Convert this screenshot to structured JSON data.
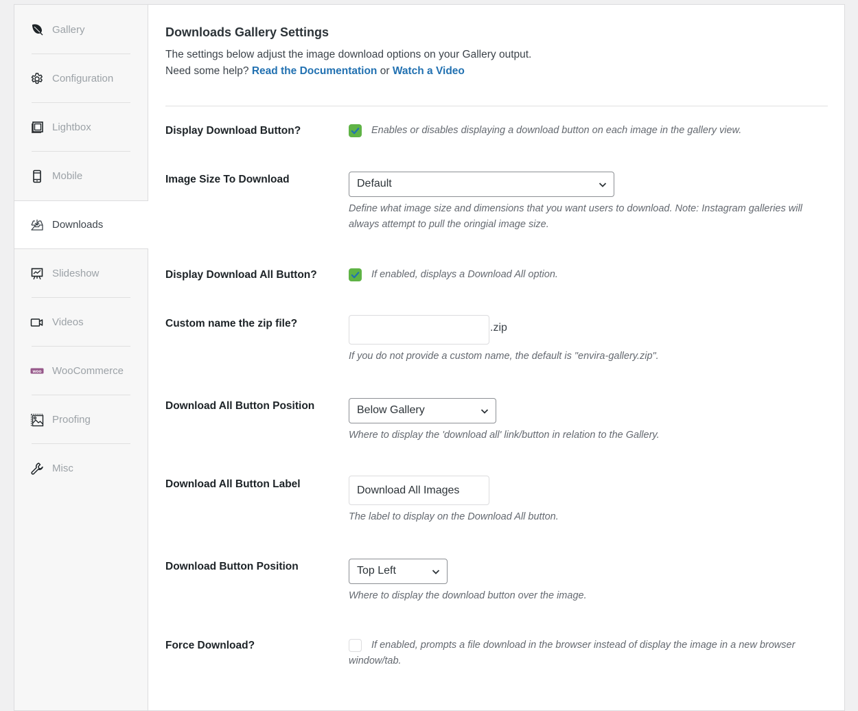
{
  "sidebar": {
    "items": [
      {
        "label": "Gallery",
        "icon": "leaf-icon",
        "active": false
      },
      {
        "label": "Configuration",
        "icon": "gear-icon",
        "active": false
      },
      {
        "label": "Lightbox",
        "icon": "lightbox-icon",
        "active": false
      },
      {
        "label": "Mobile",
        "icon": "mobile-icon",
        "active": false
      },
      {
        "label": "Downloads",
        "icon": "download-tray-icon",
        "active": true
      },
      {
        "label": "Slideshow",
        "icon": "presentation-icon",
        "active": false
      },
      {
        "label": "Videos",
        "icon": "video-camera-icon",
        "active": false
      },
      {
        "label": "WooCommerce",
        "icon": "woo-icon",
        "active": false
      },
      {
        "label": "Proofing",
        "icon": "image-proof-icon",
        "active": false
      },
      {
        "label": "Misc",
        "icon": "wrench-icon",
        "active": false
      }
    ]
  },
  "header": {
    "title": "Downloads Gallery Settings",
    "description": "The settings below adjust the image download options on your Gallery output.",
    "help_prefix": "Need some help?",
    "doc_link": "Read the Documentation",
    "or_text": "or",
    "video_link": "Watch a Video"
  },
  "settings": {
    "display_download_button": {
      "label": "Display Download Button?",
      "checked": true,
      "help": "Enables or disables displaying a download button on each image in the gallery view."
    },
    "image_size": {
      "label": "Image Size To Download",
      "value": "Default",
      "help": "Define what image size and dimensions that you want users to download. Note: Instagram galleries will always attempt to pull the oringial image size."
    },
    "display_download_all": {
      "label": "Display Download All Button?",
      "checked": true,
      "help": "If enabled, displays a Download All option."
    },
    "zip_name": {
      "label": "Custom name the zip file?",
      "value": "",
      "suffix": ".zip",
      "help": "If you do not provide a custom name, the default is \"envira-gallery.zip\"."
    },
    "download_all_position": {
      "label": "Download All Button Position",
      "value": "Below Gallery",
      "help": "Where to display the 'download all' link/button in relation to the Gallery."
    },
    "download_all_label": {
      "label": "Download All Button Label",
      "value": "Download All Images",
      "help": "The label to display on the Download All button."
    },
    "download_button_position": {
      "label": "Download Button Position",
      "value": "Top Left",
      "help": "Where to display the download button over the image."
    },
    "force_download": {
      "label": "Force Download?",
      "checked": false,
      "help": "If enabled, prompts a file download in the browser instead of display the image in a new browser window/tab."
    }
  },
  "colors": {
    "accent_link": "#2271b1",
    "checkbox_checked": "#5fb346",
    "checkmark": "#2271b1",
    "woo_purple": "#96588a"
  }
}
